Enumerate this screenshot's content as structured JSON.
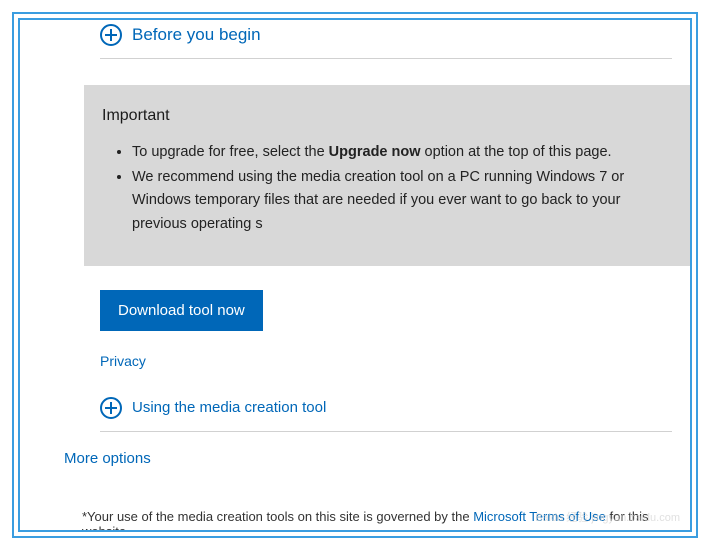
{
  "sections": {
    "before_you_begin": {
      "label": "Before you begin"
    },
    "using_tool": {
      "label": "Using the media creation tool"
    }
  },
  "important": {
    "title": "Important",
    "bullets": {
      "b1_pre": "To upgrade for free, select the ",
      "b1_bold": "Upgrade now",
      "b1_post": " option at the top of this page.",
      "b2": "We recommend using the media creation tool on a PC running Windows 7 or Windows temporary files that are needed if you ever want to go back to your previous operating s"
    }
  },
  "download_button": "Download tool now",
  "privacy": "Privacy",
  "more_options": "More options",
  "footnote": {
    "pre": "*Your use of the media creation tools on this site is governed by the ",
    "link": "Microsoft Terms of Use",
    "post": " for this website."
  },
  "watermark": "Baidu 经验\njingyan.baidu.com"
}
